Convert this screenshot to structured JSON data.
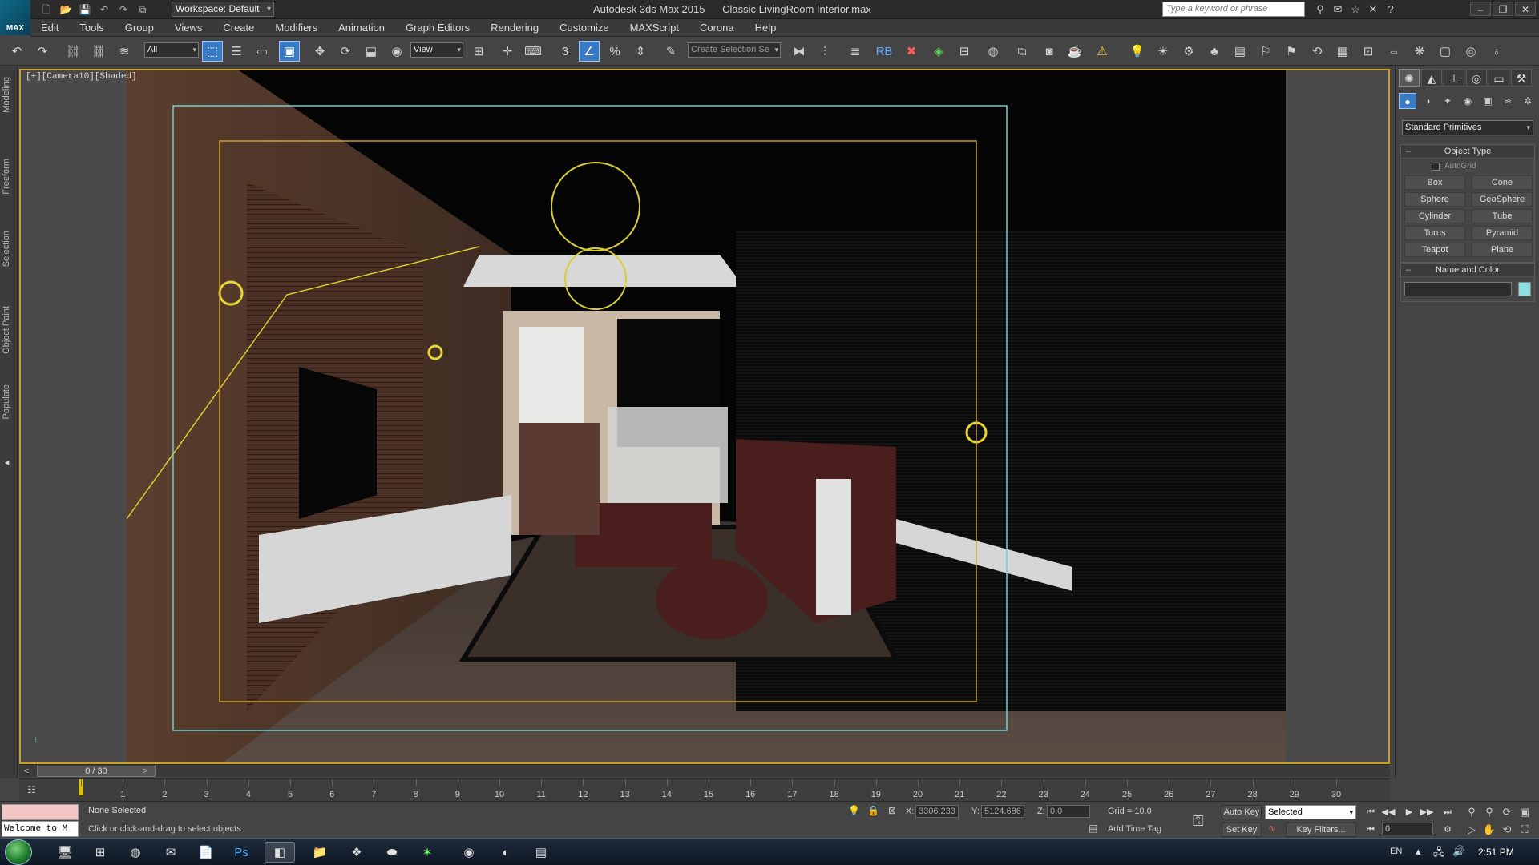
{
  "window": {
    "title": "Autodesk 3ds Max 2015      Classic LivingRoom Interior.max",
    "logo_text": "MAX",
    "workspace": "Workspace: Default",
    "search_placeholder": "Type a keyword or phrase"
  },
  "menu": [
    "Edit",
    "Tools",
    "Group",
    "Views",
    "Create",
    "Modifiers",
    "Animation",
    "Graph Editors",
    "Rendering",
    "Customize",
    "MAXScript",
    "Corona",
    "Help"
  ],
  "toolbar": {
    "filter": "All",
    "ref_coord": "View",
    "snap_label": "3",
    "named_selection_placeholder": "Create Selection Se"
  },
  "left_ribbon": [
    "Modeling",
    "Freeform",
    "Selection",
    "Object Paint",
    "Populate"
  ],
  "viewport": {
    "label": "[+][Camera10][Shaded]"
  },
  "command_panel": {
    "category": "Standard Primitives",
    "object_type_title": "Object Type",
    "autogrid": "AutoGrid",
    "primitives": [
      "Box",
      "Cone",
      "Sphere",
      "GeoSphere",
      "Cylinder",
      "Tube",
      "Torus",
      "Pyramid",
      "Teapot",
      "Plane"
    ],
    "name_color_title": "Name and Color",
    "swatch_color": "#8ee0e0"
  },
  "timeline": {
    "position": "0 / 30",
    "ticks": [
      "0",
      "1",
      "2",
      "3",
      "4",
      "5",
      "6",
      "7",
      "8",
      "9",
      "10",
      "11",
      "12",
      "13",
      "14",
      "15",
      "16",
      "17",
      "18",
      "19",
      "20",
      "21",
      "22",
      "23",
      "24",
      "25",
      "26",
      "27",
      "28",
      "29",
      "30"
    ]
  },
  "status": {
    "listener_text": "Welcome to M",
    "selection": "None Selected",
    "prompt": "Click or click-and-drag to select objects",
    "x_label": "X:",
    "x_value": "3306.233",
    "y_label": "Y:",
    "y_value": "5124.686",
    "z_label": "Z:",
    "z_value": "0.0",
    "grid": "Grid = 10.0",
    "add_time_tag": "Add Time Tag",
    "auto_key": "Auto Key",
    "set_key": "Set Key",
    "selected": "Selected",
    "key_filters": "Key Filters...",
    "frame": "0"
  },
  "taskbar": {
    "lang": "EN",
    "clock": "2:51 PM"
  }
}
